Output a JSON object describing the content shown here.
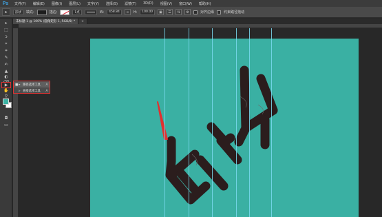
{
  "app": {
    "logo": "Ps"
  },
  "menu": [
    "文件(F)",
    "编辑(E)",
    "图像(I)",
    "图层(L)",
    "文字(Y)",
    "选择(S)",
    "滤镜(T)",
    "3D(D)",
    "视图(V)",
    "窗口(W)",
    "帮助(H)"
  ],
  "options": {
    "tool_glyph": "▸",
    "mode": "形状",
    "fill_label": "填充:",
    "stroke_label": "描边:",
    "stroke_width": "1点",
    "w_label": "W:",
    "w_value": "458.84",
    "h_label": "H:",
    "h_value": "100.00",
    "align_edges": "对齐边缘",
    "constrain_path": "约束路径拖动"
  },
  "tabs": [
    {
      "label": "未标题-1 @ 100% (圆角矩形 1, RGB/8) *",
      "active": true
    },
    {
      "label": "×",
      "active": false
    }
  ],
  "tools": [
    "▸",
    "⬚",
    "ↄ",
    "⌖",
    "⌗",
    "✎",
    "✍",
    "▲",
    "◐",
    "⌫",
    "▦",
    "◍",
    "✒",
    "T",
    "▶",
    "▭",
    "✋",
    "⚲"
  ],
  "flyout": [
    {
      "bullet": "■",
      "icon": "▸",
      "label": "路径选择工具",
      "key": "A",
      "selected": true
    },
    {
      "bullet": "",
      "icon": "▹",
      "label": "直接选择工具",
      "key": "A",
      "selected": false
    }
  ],
  "colors": {
    "canvas": "#3ab0a3",
    "art": "#2b1d1d",
    "guide": "#7ad9f0",
    "annotation": "#e03030",
    "foreground": "#3bb3a4",
    "background": "#ffffff"
  }
}
